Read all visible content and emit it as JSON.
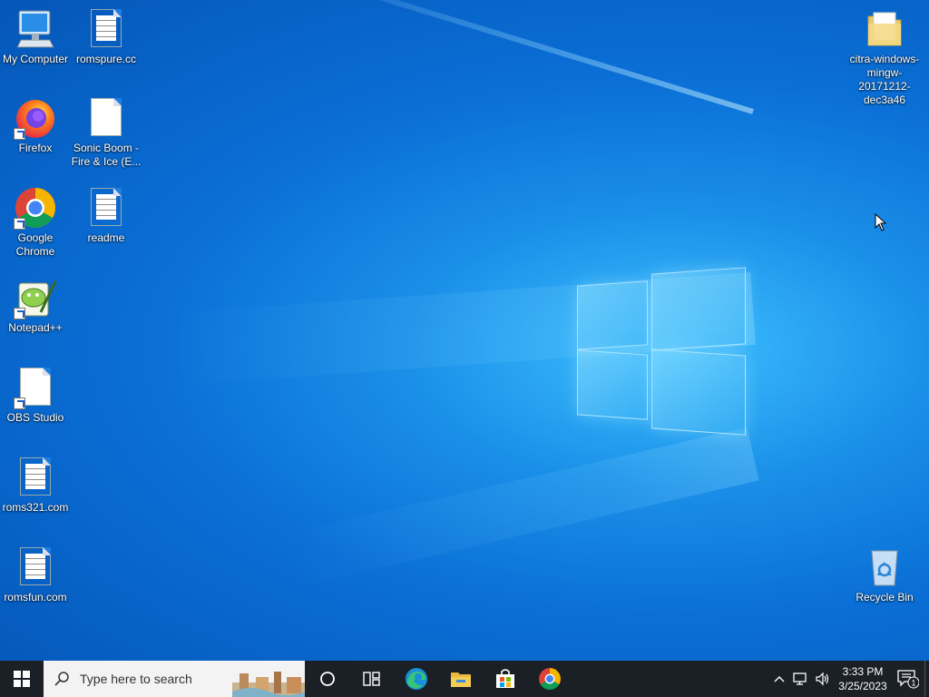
{
  "desktop": {
    "icons": [
      {
        "label": "My Computer",
        "icon": "computer-icon"
      },
      {
        "label": "romspure.cc",
        "icon": "text-document-icon"
      },
      {
        "label": "Firefox",
        "icon": "firefox-icon"
      },
      {
        "label": "Sonic Boom - Fire & Ice (E...",
        "icon": "blank-document-icon"
      },
      {
        "label": "Google Chrome",
        "icon": "chrome-icon"
      },
      {
        "label": "readme",
        "icon": "text-document-icon"
      },
      {
        "label": "Notepad++",
        "icon": "notepad-plus-plus-icon"
      },
      {
        "label": "OBS Studio",
        "icon": "blank-document-icon"
      },
      {
        "label": "roms321.com",
        "icon": "text-document-icon"
      },
      {
        "label": "romsfun.com",
        "icon": "text-document-icon"
      },
      {
        "label": "citra-windows-mingw-20171212-dec3a46",
        "icon": "folder-icon"
      },
      {
        "label": "Recycle Bin",
        "icon": "recycle-bin-icon"
      }
    ]
  },
  "taskbar": {
    "search_placeholder": "Type here to search",
    "pinned": [
      "cortana-icon",
      "task-view-icon",
      "edge-icon",
      "file-explorer-icon",
      "store-icon",
      "chrome-icon"
    ],
    "clock": {
      "time": "3:33 PM",
      "date": "3/25/2023"
    },
    "notification_count": "1"
  },
  "colors": {
    "taskbar_bg": "#1b1f26",
    "desktop_accent": "#0a6fd6"
  }
}
